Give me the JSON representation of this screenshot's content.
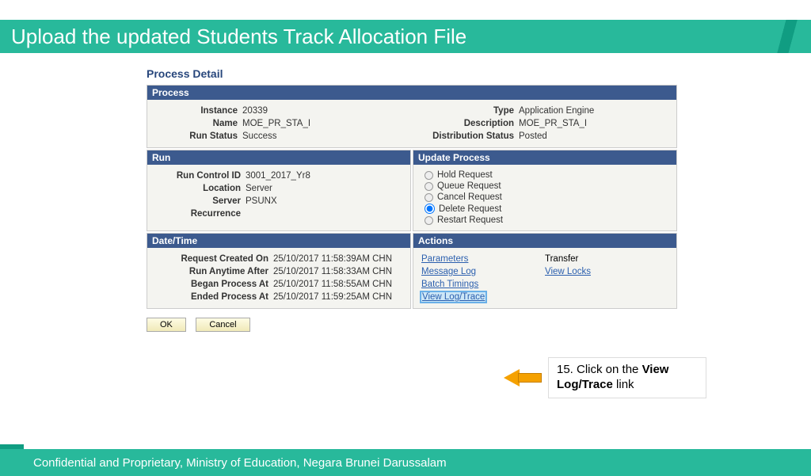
{
  "title": "Upload the updated Students Track Allocation File",
  "page_heading": "Process Detail",
  "process": {
    "header": "Process",
    "instance_lbl": "Instance",
    "instance": "20339",
    "name_lbl": "Name",
    "name": "MOE_PR_STA_I",
    "runstatus_lbl": "Run Status",
    "runstatus": "Success",
    "type_lbl": "Type",
    "type": "Application Engine",
    "desc_lbl": "Description",
    "desc": "MOE_PR_STA_I",
    "dist_lbl": "Distribution Status",
    "dist": "Posted"
  },
  "run": {
    "header": "Run",
    "rcid_lbl": "Run Control ID",
    "rcid": "3001_2017_Yr8",
    "loc_lbl": "Location",
    "loc": "Server",
    "srv_lbl": "Server",
    "srv": "PSUNX",
    "rec_lbl": "Recurrence",
    "rec": ""
  },
  "update": {
    "header": "Update Process",
    "opts": {
      "hold": "Hold Request",
      "queue": "Queue Request",
      "cancel": "Cancel Request",
      "delete": "Delete Request",
      "restart": "Restart Request"
    }
  },
  "datetime": {
    "header": "Date/Time",
    "created_lbl": "Request Created On",
    "created": "25/10/2017 11:58:39AM CHN",
    "anytime_lbl": "Run Anytime After",
    "anytime": "25/10/2017 11:58:33AM CHN",
    "began_lbl": "Began Process At",
    "began": "25/10/2017 11:58:55AM CHN",
    "ended_lbl": "Ended Process At",
    "ended": "25/10/2017 11:59:25AM CHN"
  },
  "actions": {
    "header": "Actions",
    "parameters": "Parameters",
    "transfer": "Transfer",
    "message_log": "Message Log",
    "view_locks": "View Locks",
    "batch_timings": "Batch Timings",
    "view_log_trace": "View Log/Trace"
  },
  "buttons": {
    "ok": "OK",
    "cancel": "Cancel"
  },
  "callout": {
    "step": "15. Click on the ",
    "bold1": "View Log/Trace",
    "after": " link"
  },
  "footer": "Confidential and Proprietary, Ministry of Education, Negara Brunei Darussalam"
}
